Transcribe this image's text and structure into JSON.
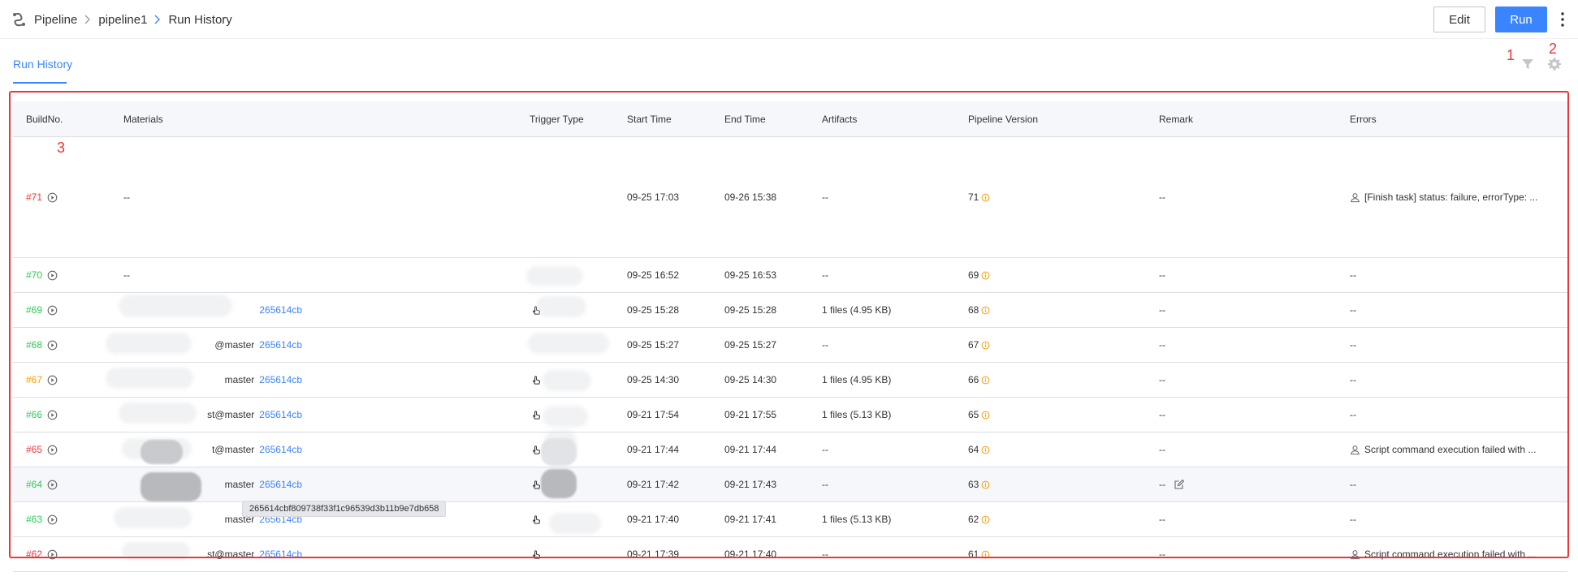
{
  "breadcrumb": {
    "root": "Pipeline",
    "pipeline": "pipeline1",
    "current": "Run History"
  },
  "header": {
    "edit_label": "Edit",
    "run_label": "Run"
  },
  "tabs": {
    "active": "Run History"
  },
  "annotations": {
    "one": "1",
    "two": "2",
    "three": "3"
  },
  "table": {
    "columns": [
      "BuildNo.",
      "Materials",
      "Trigger Type",
      "Start Time",
      "End Time",
      "Artifacts",
      "Pipeline Version",
      "Remark",
      "Errors"
    ],
    "rows": [
      {
        "build": "#71",
        "status": "failed",
        "material_text": "--",
        "material_hash": "",
        "start": "09-25 17:03",
        "end": "09-26 15:38",
        "artifacts": "--",
        "version": "71",
        "remark": "--",
        "errors": "[Finish task] status: failure, errorType: ..."
      },
      {
        "build": "#70",
        "status": "success",
        "material_text": "--",
        "material_hash": "",
        "start": "09-25 16:52",
        "end": "09-25 16:53",
        "artifacts": "--",
        "version": "69",
        "remark": "--",
        "errors": "--"
      },
      {
        "build": "#69",
        "status": "success",
        "material_text": "",
        "material_hash": "265614cb",
        "start": "09-25 15:28",
        "end": "09-25 15:28",
        "artifacts": "1 files  (4.95 KB)",
        "version": "68",
        "remark": "--",
        "errors": "--"
      },
      {
        "build": "#68",
        "status": "success",
        "material_text": "@master",
        "material_hash": "265614cb",
        "start": "09-25 15:27",
        "end": "09-25 15:27",
        "artifacts": "--",
        "version": "67",
        "remark": "--",
        "errors": "--"
      },
      {
        "build": "#67",
        "status": "warning",
        "material_text": "master",
        "material_hash": "265614cb",
        "start": "09-25 14:30",
        "end": "09-25 14:30",
        "artifacts": "1 files  (4.95 KB)",
        "version": "66",
        "remark": "--",
        "errors": "--"
      },
      {
        "build": "#66",
        "status": "success",
        "material_text": "st@master",
        "material_hash": "265614cb",
        "start": "09-21 17:54",
        "end": "09-21 17:55",
        "artifacts": "1 files  (5.13 KB)",
        "version": "65",
        "remark": "--",
        "errors": "--"
      },
      {
        "build": "#65",
        "status": "failed",
        "material_text": "t@master",
        "material_hash": "265614cb",
        "start": "09-21 17:44",
        "end": "09-21 17:44",
        "artifacts": "--",
        "version": "64",
        "remark": "--",
        "errors": "Script command execution failed with ..."
      },
      {
        "build": "#64",
        "status": "success",
        "material_text": "master",
        "material_hash": "265614cb",
        "start": "09-21 17:42",
        "end": "09-21 17:43",
        "artifacts": "--",
        "version": "63",
        "remark": "--",
        "errors": "--"
      },
      {
        "build": "#63",
        "status": "success",
        "material_text": "master",
        "material_hash": "265614cb",
        "start": "09-21 17:40",
        "end": "09-21 17:41",
        "artifacts": "1 files  (5.13 KB)",
        "version": "62",
        "remark": "--",
        "errors": "--"
      },
      {
        "build": "#62",
        "status": "failed",
        "material_text": "st@master",
        "material_hash": "265614cb",
        "start": "09-21 17:39",
        "end": "09-21 17:40",
        "artifacts": "--",
        "version": "61",
        "remark": "--",
        "errors": "Script command execution failed with ..."
      }
    ]
  },
  "tooltip": {
    "commit_hash": "265614cbf809738f33f1c96539d3b11b9e7db658"
  },
  "colors": {
    "accent": "#3a84ff",
    "failed": "#ea3636",
    "success": "#2dcb56",
    "warning": "#ff9c01",
    "annotation": "#ea3636"
  }
}
